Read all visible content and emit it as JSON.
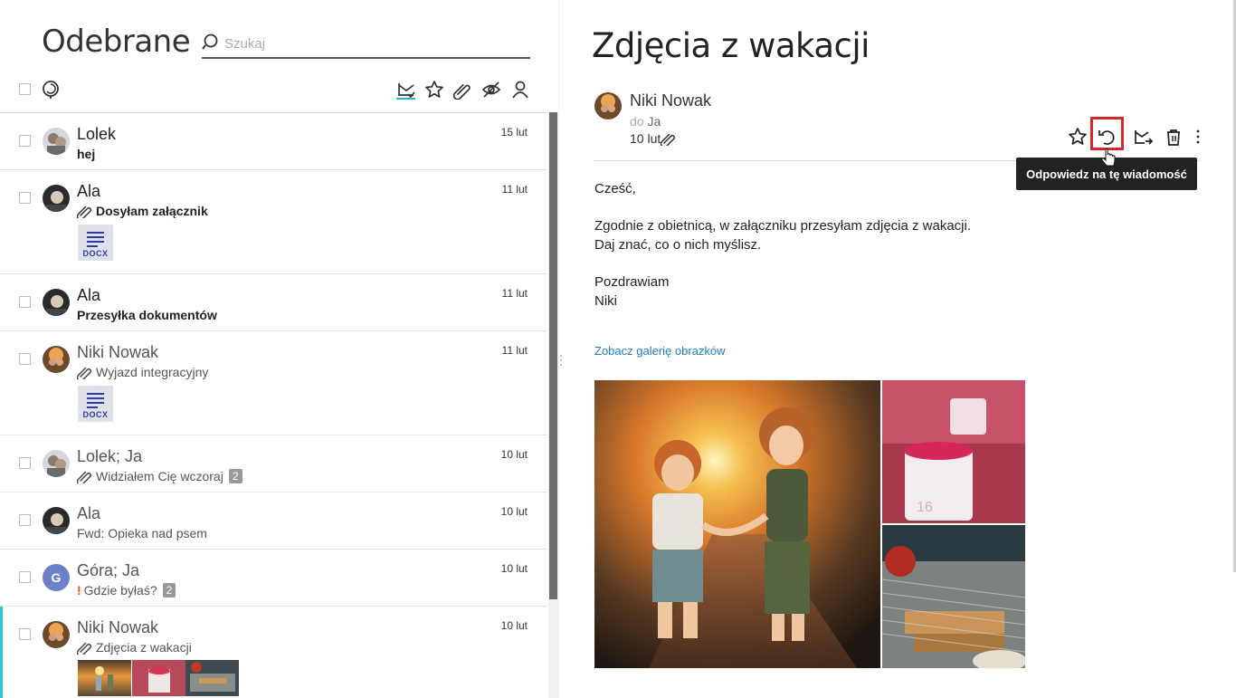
{
  "inbox": {
    "title": "Odebrane",
    "search_placeholder": "Szukaj",
    "toolbar_icons": [
      "unread-filter-icon",
      "star-icon",
      "attachment-icon",
      "hidden-icon",
      "contact-icon"
    ]
  },
  "messages": [
    {
      "sender": "Lolek",
      "date": "15 lut",
      "subject": "hej",
      "unread": true,
      "attachment": false
    },
    {
      "sender": "Ala",
      "date": "11 lut",
      "subject": "Dosyłam załącznik",
      "unread": true,
      "attachment": true,
      "file_type": "DOCX"
    },
    {
      "sender": "Ala",
      "date": "11 lut",
      "subject": "Przesyłka dokumentów",
      "unread": true,
      "attachment": false
    },
    {
      "sender": "Niki Nowak",
      "date": "11 lut",
      "subject": "Wyjazd integracyjny",
      "unread": false,
      "attachment": true,
      "file_type": "DOCX"
    },
    {
      "sender": "Lolek; Ja",
      "date": "10 lut",
      "subject": "Widziałem Cię wczoraj",
      "unread": false,
      "attachment": true,
      "count": "2"
    },
    {
      "sender": "Ala",
      "date": "10 lut",
      "subject": "Fwd: Opieka nad psem",
      "unread": false,
      "attachment": false
    },
    {
      "sender": "Góra; Ja",
      "date": "10 lut",
      "subject": "Gdzie byłaś?",
      "unread": false,
      "important": true,
      "count": "2",
      "avatar_letter": "G"
    },
    {
      "sender": "Niki Nowak",
      "date": "10 lut",
      "subject": "Zdjęcia z wakacji",
      "unread": false,
      "attachment": true,
      "selected": true
    }
  ],
  "message": {
    "title": "Zdjęcia z wakacji",
    "from": "Niki Nowak",
    "to_label": "do",
    "to": "Ja",
    "date": "10 lut",
    "tooltip": "Odpowiedz na tę wiadomość",
    "body": {
      "greeting": "Cześć,",
      "line1": "Zgodnie z obietnicą, w załączniku przesyłam zdjęcia z wakacji.",
      "line2": "Daj znać, co o nich myślisz.",
      "closing": "Pozdrawiam",
      "signature": "Niki"
    },
    "gallery_link": "Zobacz galerię obrazków",
    "actions": [
      "star-icon",
      "reply-icon",
      "move-icon",
      "delete-icon",
      "more-icon"
    ]
  },
  "colors": {
    "accent": "#27b3d7",
    "highlight": "#d92727",
    "link": "#1f7dc4",
    "tooltip_bg": "#222222"
  }
}
